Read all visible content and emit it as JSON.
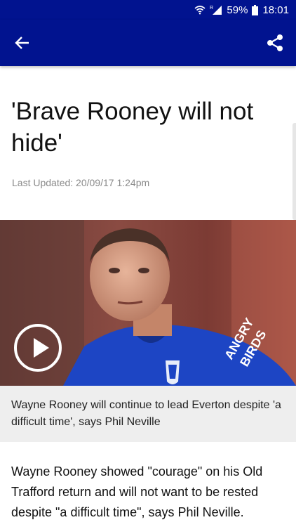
{
  "status": {
    "battery_percent": "59%",
    "time": "18:01",
    "icons": [
      "wifi-icon",
      "signal-icon",
      "battery-icon"
    ]
  },
  "appbar": {
    "color": "#01138f",
    "back_icon": "arrow-left-icon",
    "share_icon": "share-icon"
  },
  "article": {
    "headline": "'Brave Rooney will not hide'",
    "last_updated": "Last Updated: 20/09/17 1:24pm",
    "image_caption": "Wayne Rooney will continue to lead Everton despite 'a difficult time', says Phil Neville",
    "body_first_paragraph": "Wayne Rooney showed \"courage\" on his Old Trafford return and will not want to be rested despite \"a difficult time\", says Phil Neville.",
    "hero_image": {
      "play_icon": "play-icon"
    }
  }
}
